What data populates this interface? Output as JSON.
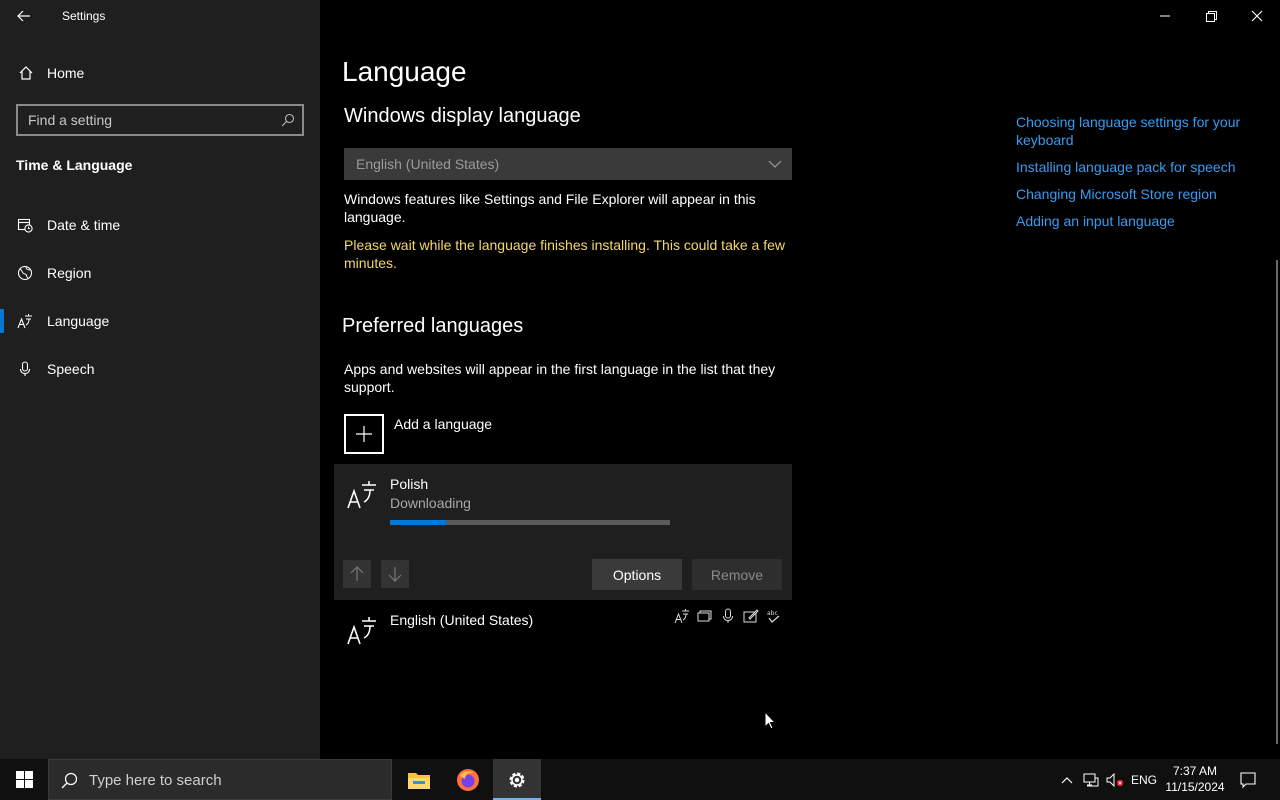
{
  "window": {
    "app_title": "Settings",
    "back_icon": "back-arrow-icon",
    "controls": [
      "minimize-icon",
      "restore-icon",
      "close-icon"
    ]
  },
  "sidebar": {
    "home_label": "Home",
    "search_placeholder": "Find a setting",
    "section_title": "Time & Language",
    "items": [
      {
        "label": "Date & time",
        "icon": "date-time-icon",
        "active": false
      },
      {
        "label": "Region",
        "icon": "globe-icon",
        "active": false
      },
      {
        "label": "Language",
        "icon": "language-icon",
        "active": true
      },
      {
        "label": "Speech",
        "icon": "microphone-icon",
        "active": false
      }
    ]
  },
  "main": {
    "page_title": "Language",
    "display_language": {
      "heading": "Windows display language",
      "selected": "English (United States)",
      "description": "Windows features like Settings and File Explorer will appear in this language.",
      "warning": "Please wait while the language finishes installing. This could take a few minutes."
    },
    "preferred": {
      "heading": "Preferred languages",
      "description": "Apps and websites will appear in the first language in the list that they support.",
      "add_label": "Add a language",
      "languages": [
        {
          "name": "Polish",
          "status": "Downloading",
          "progress": 0.2
        },
        {
          "name": "English (United States)",
          "features": [
            "display-language-icon",
            "text-to-speech-icon",
            "speech-recognition-icon",
            "handwriting-icon",
            "spell-check-icon"
          ]
        }
      ],
      "options_label": "Options",
      "remove_label": "Remove"
    }
  },
  "related_links": [
    "Choosing language settings for your keyboard",
    "Installing language pack for speech",
    "Changing Microsoft Store region",
    "Adding an input language"
  ],
  "taskbar": {
    "search_placeholder": "Type here to search",
    "apps": [
      "file-explorer-icon",
      "firefox-icon",
      "settings-gear-icon"
    ],
    "input_language": "ENG",
    "time": "7:37 AM",
    "date": "11/15/2024"
  },
  "colors": {
    "accent": "#0078d7",
    "link": "#3a9bf0",
    "warning": "#f4d66e",
    "sidebar_bg": "#1f1f1f"
  }
}
